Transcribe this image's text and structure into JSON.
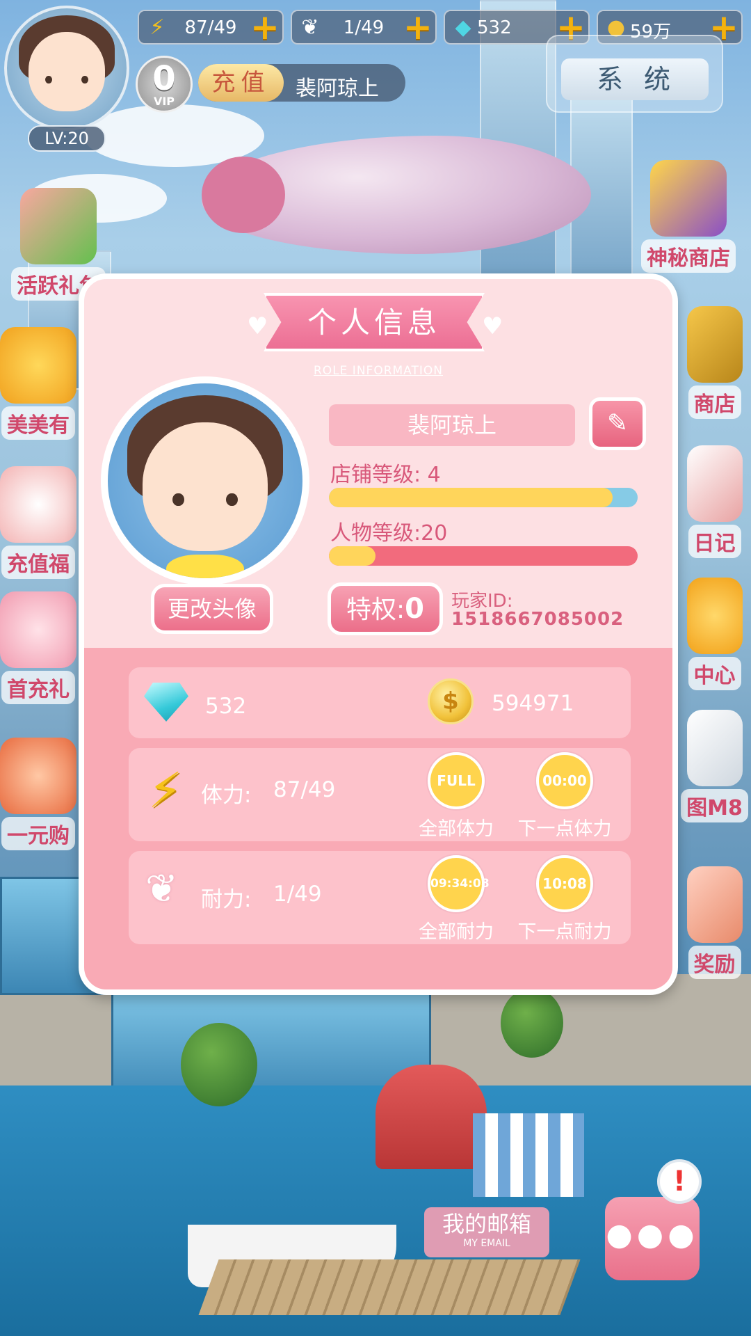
{
  "hud": {
    "stamina": "87/49",
    "endurance": "1/49",
    "gems": "532",
    "gold": "59万",
    "level": "LV:20",
    "vip_level": "0",
    "vip_label": "VIP",
    "recharge_label": "充值",
    "player_name": "裴阿琼上",
    "system_label": "系统"
  },
  "side_menu": {
    "left": [
      "活跃礼包",
      "美美有",
      "充值福",
      "首充礼",
      "一元购"
    ],
    "right": [
      "神秘商店",
      "商店",
      "日记",
      "中心",
      "图M8",
      "奖励"
    ]
  },
  "dialog": {
    "title": "个人信息",
    "title_en": "ROLE INFORMATION",
    "change_avatar": "更改头像",
    "nickname": "裴阿琼上",
    "shop_level_label": "店铺等级: 4",
    "shop_level_progress": 0.92,
    "char_level_label": "人物等级:20",
    "char_level_progress": 0.15,
    "privilege_label": "特权:",
    "privilege_value": "0",
    "player_id_label": "玩家ID:",
    "player_id": "1518667085002",
    "gems": "532",
    "gold": "594971",
    "stamina_label": "体力:",
    "stamina_value": "87/49",
    "stamina_all_timer": "FULL",
    "stamina_all_label": "全部体力",
    "stamina_next_timer": "00:00",
    "stamina_next_label": "下一点体力",
    "endurance_label": "耐力:",
    "endurance_value": "1/49",
    "endurance_all_timer": "09:34:08",
    "endurance_all_label": "全部耐力",
    "endurance_next_timer": "10:08",
    "endurance_next_label": "下一点耐力"
  },
  "bottom": {
    "mail_label": "我的邮箱",
    "mail_label_en": "MY EMAIL",
    "alert": "!"
  },
  "colors": {
    "accent_pink": "#ec6f94",
    "dialog_bg": "#fde0e3",
    "bar_yellow": "#ffd55b",
    "shop_bar_track": "#86cbe6",
    "char_bar_track": "#f26b7d"
  }
}
